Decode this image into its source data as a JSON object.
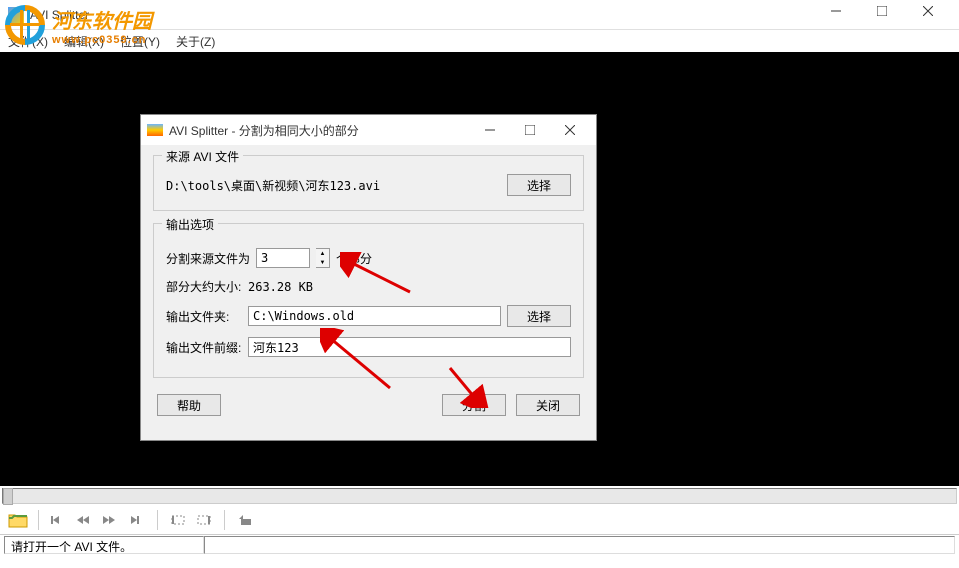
{
  "main_window": {
    "title": "AVI Splitter"
  },
  "menu": {
    "file": "文件(X)",
    "edit": "编辑(X)",
    "view": "位置(Y)",
    "about": "关于(Z)"
  },
  "watermark": {
    "text": "河东软件园",
    "url": "www.pc0359.cn"
  },
  "dialog": {
    "title": "AVI Splitter - 分割为相同大小的部分",
    "source_group": "来源 AVI 文件",
    "source_path": "D:\\tools\\桌面\\新视频\\河东123.avi",
    "select_btn": "选择",
    "output_group": "输出选项",
    "split_label": "分割来源文件为",
    "split_count": "3",
    "split_unit": "个部分",
    "approx_label": "部分大约大小:",
    "approx_value": "263.28 KB",
    "out_folder_label": "输出文件夹:",
    "out_folder_value": "C:\\Windows.old",
    "out_prefix_label": "输出文件前缀:",
    "out_prefix_value": "河东123",
    "help_btn": "帮助",
    "split_btn": "分割",
    "close_btn": "关闭"
  },
  "status": {
    "text": "请打开一个 AVI 文件。"
  }
}
